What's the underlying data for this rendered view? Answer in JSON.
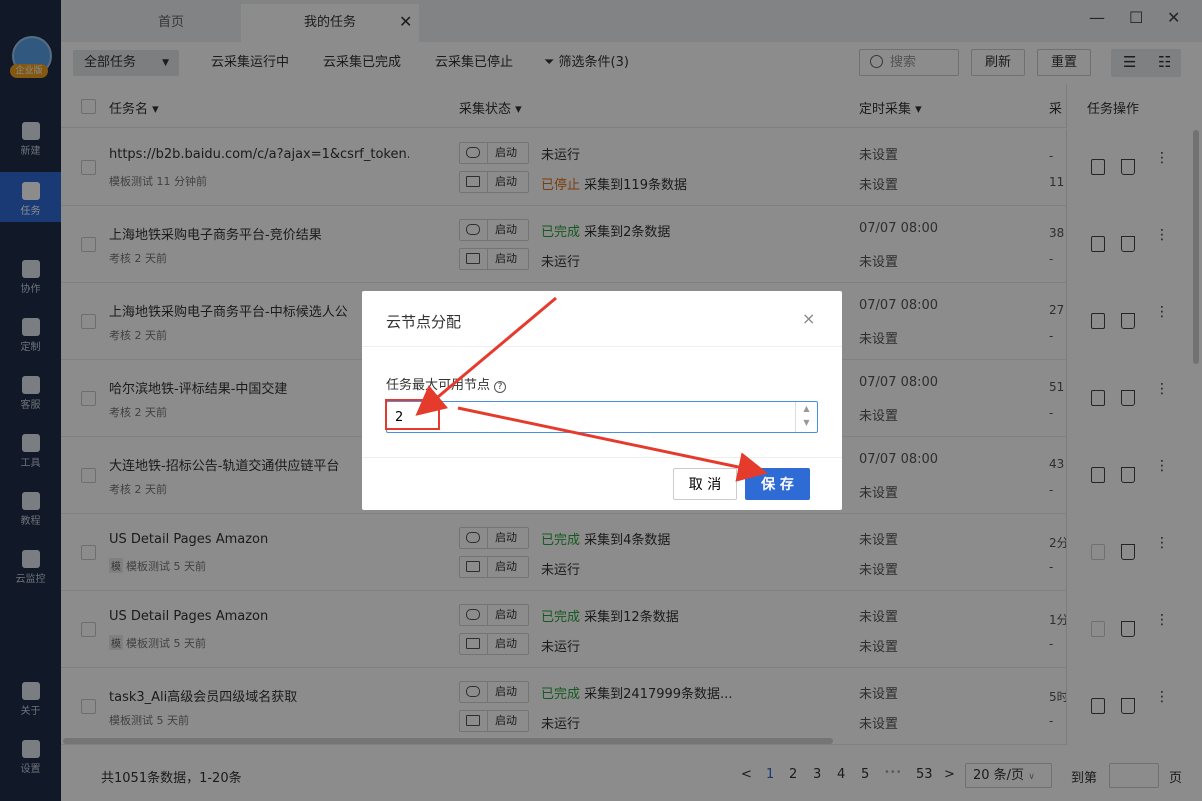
{
  "sidebar": {
    "badge": "企业版",
    "items": [
      {
        "label": "新建",
        "icon": "plus-icon"
      },
      {
        "label": "任务",
        "icon": "task-icon",
        "active": true
      },
      {
        "label": "协作",
        "icon": "users-icon"
      },
      {
        "label": "定制",
        "icon": "heart-icon"
      },
      {
        "label": "客服",
        "icon": "headset-icon"
      },
      {
        "label": "工具",
        "icon": "toolbox-icon"
      },
      {
        "label": "教程",
        "icon": "graduation-icon"
      },
      {
        "label": "云监控",
        "icon": "cloud-monitor-icon"
      },
      {
        "label": "关于",
        "icon": "info-icon"
      },
      {
        "label": "设置",
        "icon": "gear-icon"
      }
    ]
  },
  "tabs": {
    "home": "首页",
    "tasks": "我的任务"
  },
  "window": {
    "minimize": "—",
    "maximize": "☐",
    "close": "✕"
  },
  "toolbar": {
    "all_tasks": "全部任务",
    "running": "云采集运行中",
    "completed": "云采集已完成",
    "stopped": "云采集已停止",
    "filter": "筛选条件(3)",
    "search_placeholder": "搜索",
    "refresh": "刷新",
    "reset": "重置"
  },
  "table": {
    "headers": {
      "name": "任务名",
      "status": "采集状态",
      "schedule": "定时采集",
      "truncated": "采",
      "ops": "任务操作"
    },
    "start_label": "启动",
    "rows": [
      {
        "name": "https://b2b.baidu.com/c/a?ajax=1&csrf_token...",
        "tag": "",
        "sub": "模板测试  11 分钟前",
        "cloud_status": "未运行",
        "cloud_status_color": "",
        "cloud_detail": "",
        "local_status": "已停止",
        "local_status_color": "#e0701c",
        "local_detail": "采集到119条数据",
        "schedule1": "未设置",
        "schedule2": "未设置",
        "trunc1": "-",
        "trunc2": "11",
        "copy_dim": false
      },
      {
        "name": "上海地铁采购电子商务平台-竞价结果",
        "tag": "",
        "sub": "考核  2 天前",
        "cloud_status": "已完成",
        "cloud_status_color": "#2aa53c",
        "cloud_detail": "采集到2条数据",
        "local_status": "未运行",
        "local_status_color": "",
        "local_detail": "",
        "schedule1": "07/07 08:00",
        "schedule2": "未设置",
        "trunc1": "38",
        "trunc2": "-",
        "copy_dim": false
      },
      {
        "name": "上海地铁采购电子商务平台-中标候选人公",
        "tag": "",
        "sub": "考核  2 天前",
        "cloud_status": "",
        "cloud_status_color": "",
        "cloud_detail": "",
        "local_status": "",
        "local_status_color": "",
        "local_detail": "",
        "schedule1": "07/07 08:00",
        "schedule2": "未设置",
        "trunc1": "27",
        "trunc2": "-",
        "copy_dim": false
      },
      {
        "name": "哈尔滨地铁-评标结果-中国交建",
        "tag": "",
        "sub": "考核  2 天前",
        "cloud_status": "",
        "cloud_status_color": "",
        "cloud_detail": "",
        "local_status": "",
        "local_status_color": "",
        "local_detail": "",
        "schedule1": "07/07 08:00",
        "schedule2": "未设置",
        "trunc1": "51",
        "trunc2": "-",
        "copy_dim": false
      },
      {
        "name": "大连地铁-招标公告-轨道交通供应链平台",
        "tag": "",
        "sub": "考核  2 天前",
        "cloud_status": "",
        "cloud_status_color": "",
        "cloud_detail": "",
        "local_status": "",
        "local_status_color": "",
        "local_detail": "",
        "schedule1": "07/07 08:00",
        "schedule2": "未设置",
        "trunc1": "43",
        "trunc2": "-",
        "copy_dim": false
      },
      {
        "name": "US Detail Pages Amazon",
        "tag": "模",
        "sub": "模板测试  5 天前",
        "cloud_status": "已完成",
        "cloud_status_color": "#2aa53c",
        "cloud_detail": "采集到4条数据",
        "local_status": "未运行",
        "local_status_color": "",
        "local_detail": "",
        "schedule1": "未设置",
        "schedule2": "未设置",
        "trunc1": "2分",
        "trunc2": "-",
        "copy_dim": true
      },
      {
        "name": "US Detail Pages Amazon",
        "tag": "模",
        "sub": "模板测试  5 天前",
        "cloud_status": "已完成",
        "cloud_status_color": "#2aa53c",
        "cloud_detail": "采集到12条数据",
        "local_status": "未运行",
        "local_status_color": "",
        "local_detail": "",
        "schedule1": "未设置",
        "schedule2": "未设置",
        "trunc1": "1分",
        "trunc2": "-",
        "copy_dim": true
      },
      {
        "name": "task3_Ali高级会员四级域名获取",
        "tag": "",
        "sub": "模板测试  5 天前",
        "cloud_status": "已完成",
        "cloud_status_color": "#2aa53c",
        "cloud_detail": "采集到2417999条数据...",
        "local_status": "未运行",
        "local_status_color": "",
        "local_detail": "",
        "schedule1": "未设置",
        "schedule2": "未设置",
        "trunc1": "5时",
        "trunc2": "-",
        "copy_dim": false
      }
    ]
  },
  "footer": {
    "total": "共1051条数据，1-20条",
    "prev": "<",
    "pages": [
      "1",
      "2",
      "3",
      "4",
      "5",
      "•••",
      "53"
    ],
    "next": ">",
    "page_size": "20 条/页",
    "goto_label": "到第",
    "page_suffix": "页"
  },
  "dialog": {
    "title": "云节点分配",
    "close": "×",
    "label": "任务最大可用节点",
    "help": "?",
    "value": "2",
    "cancel": "取 消",
    "save": "保 存"
  },
  "annotation_color": "#e53b2c"
}
